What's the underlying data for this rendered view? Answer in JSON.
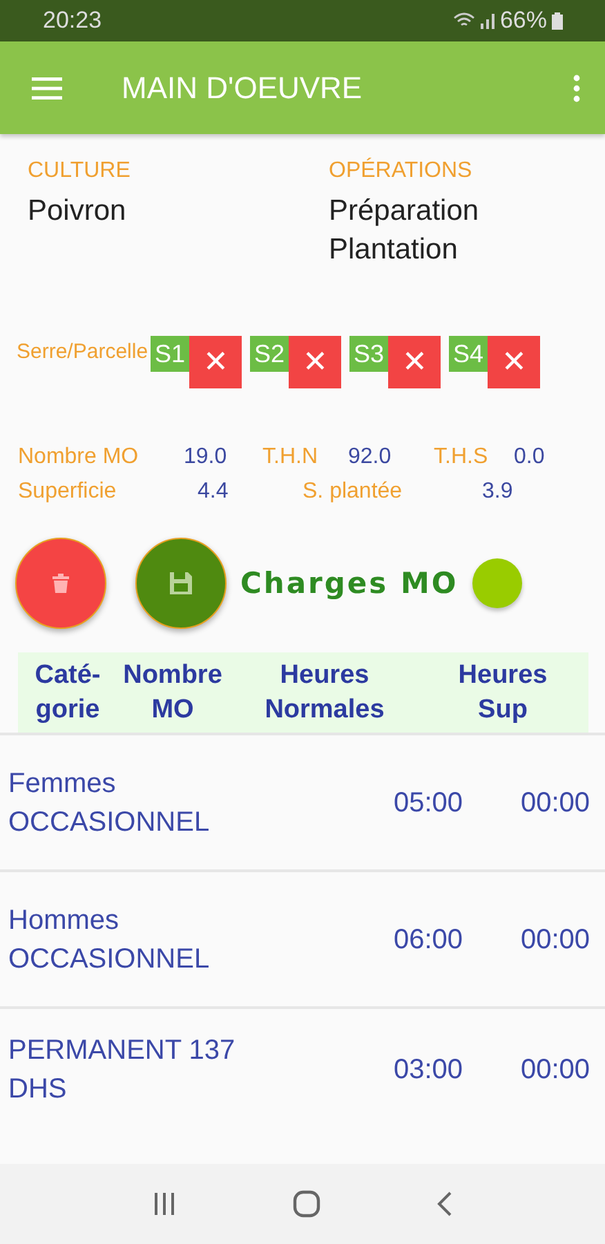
{
  "status_bar": {
    "time": "20:23",
    "battery": "66%"
  },
  "app_bar": {
    "title": "MAIN D'OEUVRE"
  },
  "culture": {
    "label": "CULTURE",
    "value": "Poivron"
  },
  "operations": {
    "label": "OPÉRATIONS",
    "value": "Préparation Plantation"
  },
  "serre_parcelle": {
    "label": "Serre/Parcelle",
    "items": [
      {
        "label": "S1",
        "remove": "✕"
      },
      {
        "label": "S2",
        "remove": "✕"
      },
      {
        "label": "S3",
        "remove": "✕"
      },
      {
        "label": "S4",
        "remove": "✕"
      }
    ]
  },
  "stats": [
    [
      {
        "label": "Nombre MO",
        "value": "19.0"
      },
      {
        "label": "T.H.N",
        "value": "92.0"
      },
      {
        "label": "T.H.S",
        "value": "0.0"
      }
    ],
    [
      {
        "label": "Superficie",
        "value": "4.4"
      },
      {
        "label": "S. plantée",
        "value": "3.9"
      }
    ]
  ],
  "charges_title": "Charges MO",
  "table": {
    "columns": [
      "Caté-\ngorie",
      "Nombre\nMO",
      "Heures\nNormales",
      "Heures\nSup"
    ],
    "rows": [
      {
        "categorie": "Femmes\nOCCASIONNEL",
        "heures_normales": "05:00",
        "heures_sup": "00:00"
      },
      {
        "categorie": "Hommes\nOCCASIONNEL",
        "heures_normales": "06:00",
        "heures_sup": "00:00"
      },
      {
        "categorie": "PERMANENT 137\nDHS",
        "heures_normales": "03:00",
        "heures_sup": "00:00"
      }
    ]
  }
}
